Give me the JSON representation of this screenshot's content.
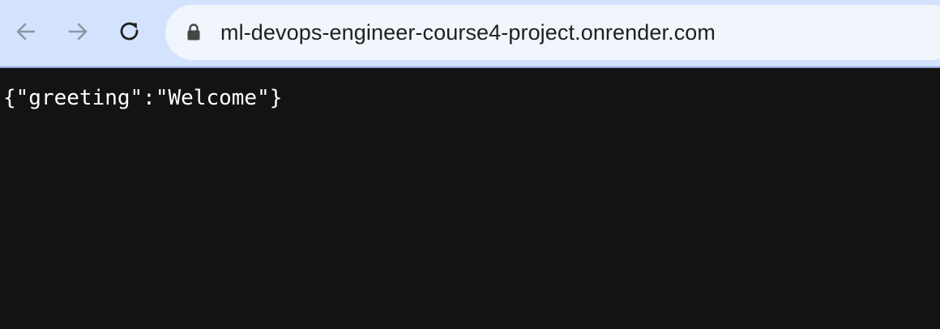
{
  "browser": {
    "back_icon": "arrow-left-icon",
    "forward_icon": "arrow-right-icon",
    "reload_icon": "reload-icon",
    "lock_icon": "lock-icon",
    "url": "ml-devops-engineer-course4-project.onrender.com"
  },
  "page": {
    "body_text": "{\"greeting\":\"Welcome\"}"
  },
  "colors": {
    "toolbar": "#d3e3fd",
    "omnibox": "#f1f5fc",
    "page_background": "#131313",
    "page_text": "#ffffff"
  }
}
